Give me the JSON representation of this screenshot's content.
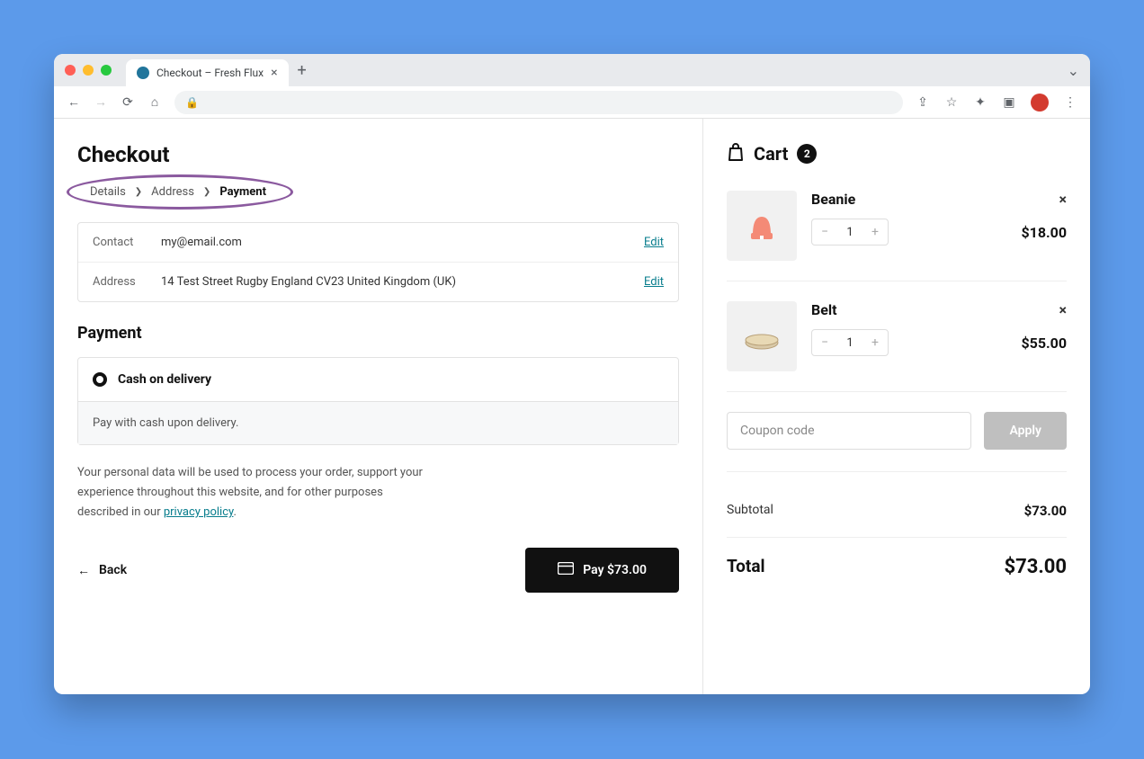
{
  "browser": {
    "tab_title": "Checkout – Fresh Flux"
  },
  "page": {
    "title": "Checkout",
    "breadcrumb": {
      "step1": "Details",
      "step2": "Address",
      "step3": "Payment"
    }
  },
  "summary": {
    "contact_label": "Contact",
    "contact_value": "my@email.com",
    "address_label": "Address",
    "address_value": "14 Test Street Rugby England CV23 United Kingdom (UK)",
    "edit_label": "Edit"
  },
  "payment": {
    "section_title": "Payment",
    "option_label": "Cash on delivery",
    "option_desc": "Pay with cash upon delivery."
  },
  "privacy": {
    "text_prefix": "Your personal data will be used to process your order, support your experience throughout this website, and for other purposes described in our ",
    "link_text": "privacy policy",
    "text_suffix": "."
  },
  "actions": {
    "back_label": "Back",
    "pay_label": "Pay $73.00"
  },
  "cart": {
    "title": "Cart",
    "count": "2",
    "items": [
      {
        "name": "Beanie",
        "qty": "1",
        "price": "$18.00"
      },
      {
        "name": "Belt",
        "qty": "1",
        "price": "$55.00"
      }
    ],
    "coupon_placeholder": "Coupon code",
    "apply_label": "Apply",
    "subtotal_label": "Subtotal",
    "subtotal_value": "$73.00",
    "total_label": "Total",
    "total_value": "$73.00"
  }
}
